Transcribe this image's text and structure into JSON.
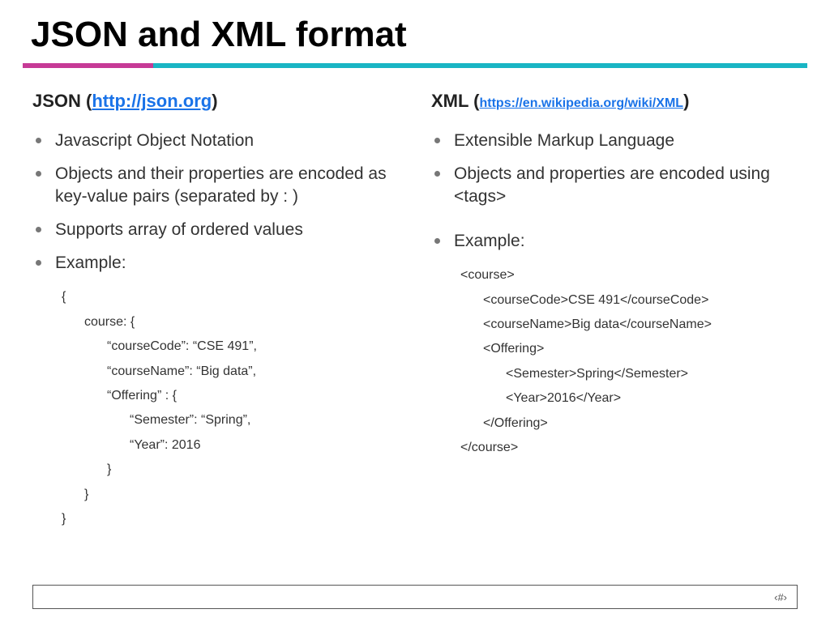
{
  "title": "JSON and XML format",
  "left": {
    "heading_prefix": "JSON (",
    "heading_link": "http://json.org",
    "heading_suffix": ")",
    "bullets": [
      "Javascript Object Notation",
      "Objects and their properties are encoded as key-value pairs (separated by : )",
      "Supports array of ordered values",
      "Example:"
    ],
    "code": [
      {
        "indent": 0,
        "text": "{"
      },
      {
        "indent": 1,
        "text": "course: {"
      },
      {
        "indent": 2,
        "text": "“courseCode”: “CSE 491”,"
      },
      {
        "indent": 2,
        "text": "“courseName”: “Big data”,"
      },
      {
        "indent": 2,
        "text": "“Offering” : {"
      },
      {
        "indent": 3,
        "text": "“Semester”: “Spring”,"
      },
      {
        "indent": 3,
        "text": "“Year”: 2016"
      },
      {
        "indent": 2,
        "text": "}"
      },
      {
        "indent": 1,
        "text": "}"
      },
      {
        "indent": 0,
        "text": "}"
      }
    ]
  },
  "right": {
    "heading_prefix": "XML (",
    "heading_link": "https://en.wikipedia.org/wiki/XML",
    "heading_suffix": ")",
    "bullets": [
      "Extensible Markup Language",
      "Objects and properties are encoded using <tags>",
      "Example:"
    ],
    "code": [
      {
        "indent": 0,
        "text": "<course>"
      },
      {
        "indent": 1,
        "text": "<courseCode>CSE 491</courseCode>"
      },
      {
        "indent": 1,
        "text": "<courseName>Big data</courseName>"
      },
      {
        "indent": 1,
        "text": "<Offering>"
      },
      {
        "indent": 2,
        "text": "<Semester>Spring</Semester>"
      },
      {
        "indent": 2,
        "text": "<Year>2016</Year>"
      },
      {
        "indent": 1,
        "text": "</Offering>"
      },
      {
        "indent": 0,
        "text": "</course>"
      }
    ]
  },
  "footer": {
    "page_indicator": "‹#›"
  }
}
